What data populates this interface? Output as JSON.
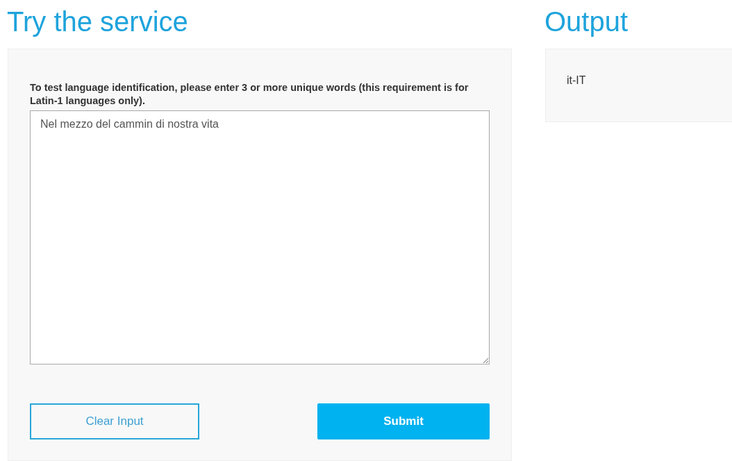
{
  "input_section": {
    "title": "Try the service",
    "instruction": "To test language identification, please enter 3 or more unique words (this requirement is for Latin-1 languages only).",
    "text_input": {
      "value": "Nel mezzo del cammin di nostra vita"
    },
    "buttons": [
      {
        "label": "Clear Input",
        "kind": "secondary"
      },
      {
        "label": "Submit",
        "kind": "primary"
      }
    ]
  },
  "output_section": {
    "title": "Output",
    "result": "it-IT"
  }
}
